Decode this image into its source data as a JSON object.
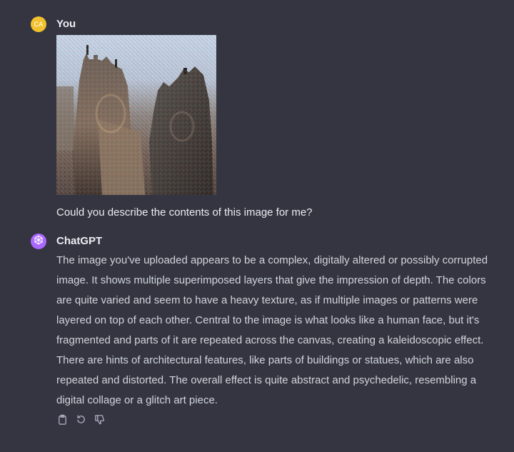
{
  "user_message": {
    "author": "You",
    "avatar_initials": "CA",
    "avatar_color": "#f2c22e",
    "attachment_icon": "uploaded-image",
    "text": "Could you describe the contents of this image for me?"
  },
  "assistant_message": {
    "author": "ChatGPT",
    "avatar_icon": "openai-logo-icon",
    "avatar_color": "#ab68ff",
    "text": "The image you've uploaded appears to be a complex, digitally altered or possibly corrupted image. It shows multiple superimposed layers that give the impression of depth. The colors are quite varied and seem to have a heavy texture, as if multiple images or patterns were layered on top of each other. Central to the image is what looks like a human face, but it's fragmented and parts of it are repeated across the canvas, creating a kaleidoscopic effect. There are hints of architectural features, like parts of buildings or statues, which are also repeated and distorted. The overall effect is quite abstract and psychedelic, resembling a digital collage or a glitch art piece."
  },
  "actions": {
    "copy_icon": "clipboard-icon",
    "regenerate_icon": "regenerate-icon",
    "feedback_icon": "thumbs-down-icon"
  },
  "theme": {
    "background": "#343541",
    "text_color": "#ececf1",
    "secondary_text": "#d1d5db",
    "icon_color": "#acacbe"
  }
}
